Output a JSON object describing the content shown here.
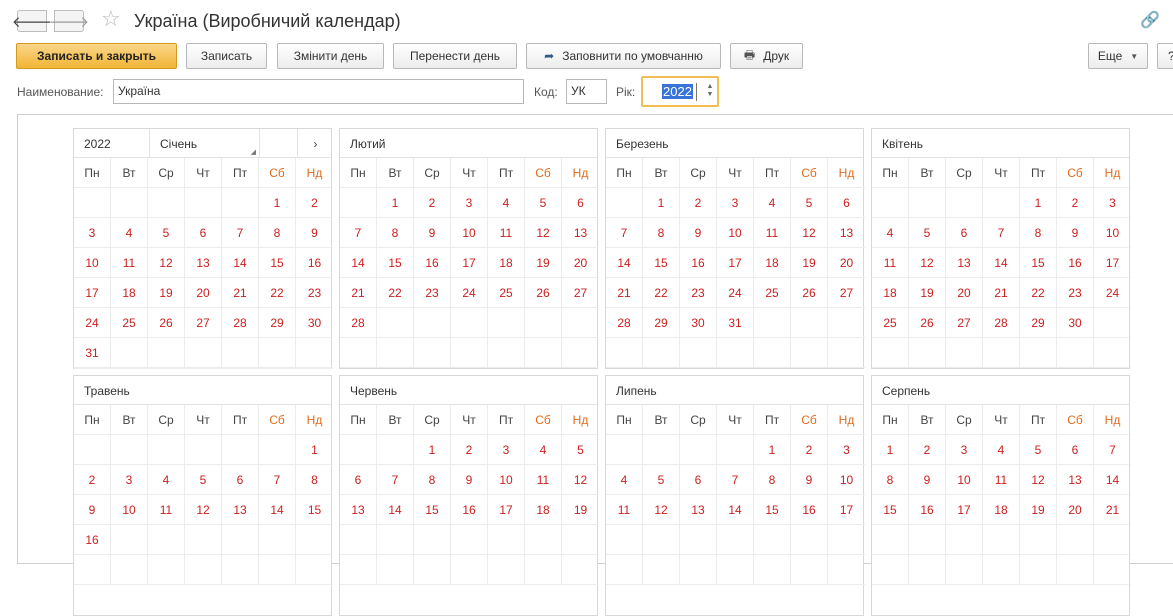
{
  "window": {
    "title": "Україна (Виробничий календар)",
    "icons": {
      "back": "arrow-left-icon",
      "forward": "arrow-right-icon",
      "favorite": "star-icon",
      "link": "link-icon"
    }
  },
  "toolbar": {
    "save_close": "Записать и закрыть",
    "save": "Записать",
    "change_day": "Змінити день",
    "move_day": "Перенести день",
    "fill_default": "Заповнити по умовчанню",
    "print": "Друк",
    "more": "Еще",
    "help": "?"
  },
  "form": {
    "name_label": "Наименование:",
    "name_value": "Україна",
    "code_label": "Код:",
    "code_value": "УК",
    "year_label": "Рік:",
    "year_value": "2022"
  },
  "calendar": {
    "year": "2022",
    "next": "›",
    "weekdays": [
      "Пн",
      "Вт",
      "Ср",
      "Чт",
      "Пт",
      "Сб",
      "Нд"
    ],
    "months": [
      {
        "name": "Січень",
        "offset": 5,
        "days": 31,
        "rows": 7
      },
      {
        "name": "Лютий",
        "offset": 1,
        "days": 28,
        "rows": 6
      },
      {
        "name": "Березень",
        "offset": 1,
        "days": 31,
        "rows": 6
      },
      {
        "name": "Квітень",
        "offset": 4,
        "days": 30,
        "rows": 6
      },
      {
        "name": "Травень",
        "offset": 6,
        "days": 16,
        "rows": 5
      },
      {
        "name": "Червень",
        "offset": 2,
        "days": 19,
        "rows": 5
      },
      {
        "name": "Липень",
        "offset": 4,
        "days": 17,
        "rows": 5
      },
      {
        "name": "Серпень",
        "offset": 0,
        "days": 21,
        "rows": 5
      }
    ]
  }
}
